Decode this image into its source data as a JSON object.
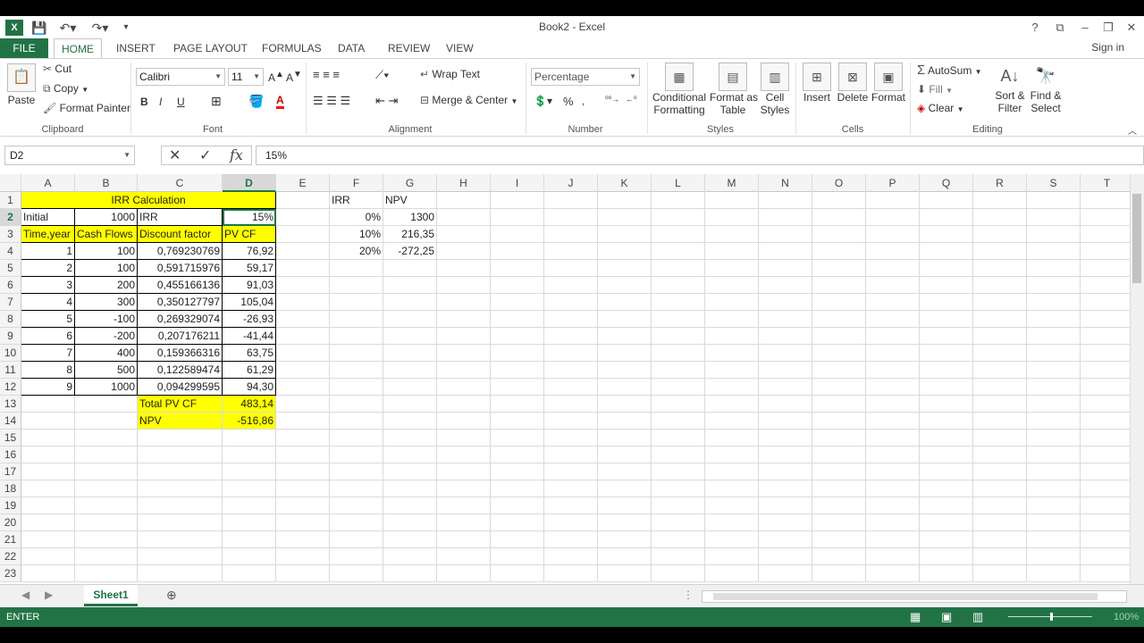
{
  "titlebar": {
    "title": "Book2 - Excel",
    "help": "?",
    "restore": "⧉",
    "minimize": "–",
    "maximize": "❐",
    "close": "✕"
  },
  "tabs": [
    "FILE",
    "HOME",
    "INSERT",
    "PAGE LAYOUT",
    "FORMULAS",
    "DATA",
    "REVIEW",
    "VIEW"
  ],
  "signin": "Sign in",
  "ribbon": {
    "clipboard": {
      "paste": "Paste",
      "cut": "Cut",
      "copy": "Copy",
      "format_painter": "Format Painter",
      "label": "Clipboard"
    },
    "font": {
      "name": "Calibri",
      "size": "11",
      "bold": "B",
      "italic": "I",
      "underline": "U",
      "label": "Font"
    },
    "alignment": {
      "wrap_text": "Wrap Text",
      "merge_center": "Merge & Center",
      "label": "Alignment"
    },
    "number": {
      "format": "Percentage",
      "percent": "%",
      "label": "Number"
    },
    "styles": {
      "conditional": "Conditional",
      "conditional2": "Formatting",
      "format_as": "Format as",
      "table": "Table",
      "cell": "Cell",
      "cell_styles": "Styles",
      "label": "Styles"
    },
    "cells": {
      "insert": "Insert",
      "delete": "Delete",
      "format": "Format",
      "label": "Cells"
    },
    "editing": {
      "autosum": "AutoSum",
      "fill": "Fill",
      "clear": "Clear",
      "sort": "Sort &",
      "filter": "Filter",
      "find": "Find &",
      "select": "Select",
      "label": "Editing"
    }
  },
  "formula_bar": {
    "name_box": "D2",
    "cancel": "✕",
    "enter": "✓",
    "fx": "fx",
    "formula": "15%"
  },
  "columns": [
    "A",
    "B",
    "C",
    "D",
    "E",
    "F",
    "G",
    "H",
    "I",
    "J",
    "K",
    "L",
    "M",
    "N",
    "O",
    "P",
    "Q",
    "R",
    "S",
    "T"
  ],
  "rows": [
    "1",
    "2",
    "3",
    "4",
    "5",
    "6",
    "7",
    "8",
    "9",
    "10",
    "11",
    "12",
    "13",
    "14",
    "15",
    "16",
    "17",
    "18",
    "19",
    "20",
    "21",
    "22",
    "23"
  ],
  "cells": {
    "A1": "IRR Calculation",
    "A2": "Initial",
    "B2": "1000",
    "C2": "IRR",
    "D2": "15%",
    "A3": "Time,year",
    "B3": "Cash Flows",
    "C3": "Discount factor",
    "D3": "PV CF",
    "A4": "1",
    "B4": "100",
    "C4": "0,769230769",
    "D4": "76,92",
    "A5": "2",
    "B5": "100",
    "C5": "0,591715976",
    "D5": "59,17",
    "A6": "3",
    "B6": "200",
    "C6": "0,455166136",
    "D6": "91,03",
    "A7": "4",
    "B7": "300",
    "C7": "0,350127797",
    "D7": "105,04",
    "A8": "5",
    "B8": "-100",
    "C8": "0,269329074",
    "D8": "-26,93",
    "A9": "6",
    "B9": "-200",
    "C9": "0,207176211",
    "D9": "-41,44",
    "A10": "7",
    "B10": "400",
    "C10": "0,159366316",
    "D10": "63,75",
    "A11": "8",
    "B11": "500",
    "C11": "0,122589474",
    "D11": "61,29",
    "A12": "9",
    "B12": "1000",
    "C12": "0,094299595",
    "D12": "94,30",
    "C13": "Total PV CF",
    "D13": "483,14",
    "C14": "NPV",
    "D14": "-516,86",
    "F1": "IRR",
    "G1": "NPV",
    "F2": "0%",
    "G2": "1300",
    "F3": "10%",
    "G3": "216,35",
    "F4": "20%",
    "G4": "-272,25"
  },
  "sheet_tab": "Sheet1",
  "status": {
    "mode": "ENTER",
    "zoom": "100%"
  }
}
